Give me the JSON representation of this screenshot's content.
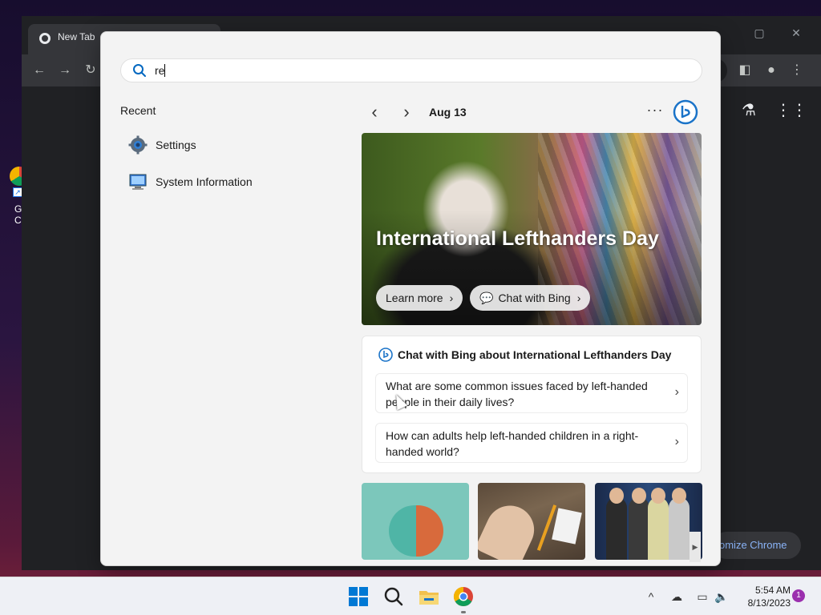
{
  "desktop": {
    "shortcut_label_line1": "G",
    "shortcut_label_line2": "Ch"
  },
  "chrome": {
    "tab_title": "New Tab",
    "customize_label": "omize Chrome",
    "window_controls": [
      "minimize-icon",
      "maximize-icon",
      "close-icon"
    ],
    "toolbar_icons": [
      "back-icon",
      "forward-icon",
      "reload-icon",
      "side-panel-icon",
      "profile-icon",
      "menu-icon"
    ],
    "ntp_icons": [
      "labs-icon",
      "apps-grid-icon"
    ]
  },
  "search": {
    "query": "re",
    "recent_heading": "Recent",
    "recent_items": [
      {
        "label": "Settings",
        "icon": "gear-icon"
      },
      {
        "label": "System Information",
        "icon": "system-info-icon"
      }
    ],
    "date_label": "Aug 13",
    "hero": {
      "title": "International Lefthanders Day",
      "learn_more": "Learn more",
      "chat_with_bing": "Chat with Bing"
    },
    "chat_card": {
      "heading": "Chat with Bing about International Lefthanders Day",
      "questions": [
        "What are some common issues faced by left-handed people in their daily lives?",
        "How can adults help left-handed children in a right-handed world?"
      ]
    },
    "thumbnails": [
      "brain-image",
      "hand-pencil-image",
      "band-photo-image"
    ]
  },
  "taskbar": {
    "time": "5:54 AM",
    "date": "8/13/2023",
    "notification_count": "1",
    "pinned": [
      "start-icon",
      "search-icon",
      "file-explorer-icon",
      "chrome-icon"
    ],
    "tray": [
      "chevron-up-icon",
      "cloud-offline-icon",
      "display-icon",
      "volume-icon"
    ]
  },
  "colors": {
    "accent": "#0078d4",
    "flyout_bg": "#f3f3f3",
    "chrome_dark": "#202124",
    "notification_badge": "#9b2fae"
  }
}
